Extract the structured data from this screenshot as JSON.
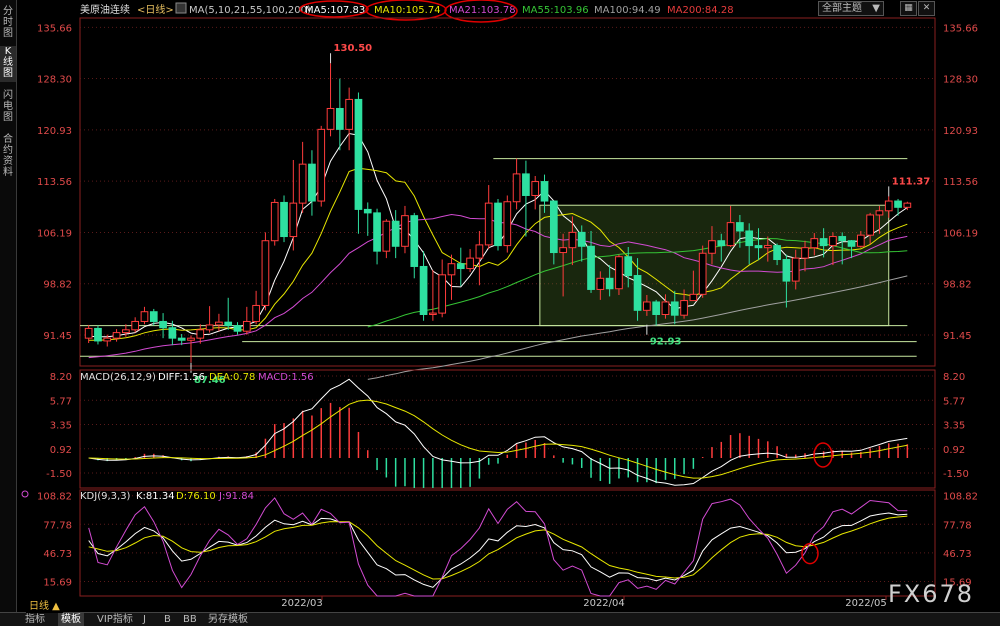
{
  "sidebar": {
    "tabs": [
      {
        "label": "分时图"
      },
      {
        "label": "K线图"
      },
      {
        "label": "闪电图"
      },
      {
        "label": "合约资料"
      }
    ]
  },
  "header": {
    "symbol": "美原油连续",
    "period": "<日线>",
    "ma_params": "MA(5,10,21,55,100,200)",
    "ma5": "MA5:107.83",
    "ma10": "MA10:105.74",
    "ma21": "MA21:103.78",
    "ma55": "MA55:103.96",
    "ma100": "MA100:94.49",
    "ma200": "MA200:84.28",
    "theme": "全部主题",
    "colors": {
      "ma5": "#ffffff",
      "ma10": "#e6e600",
      "ma21": "#d24bd2",
      "ma55": "#35c435",
      "ma100": "#a0a0a0",
      "ma200": "#e63c3c"
    }
  },
  "macd_header": {
    "name": "MACD(26,12,9)",
    "diff": "DIFF:1.56",
    "dea": "DEA:0.78",
    "macd": "MACD:1.56"
  },
  "kdj_header": {
    "name": "KDJ(9,3,3)",
    "k": "K:81.34",
    "d": "D:76.10",
    "j": "J:91.84"
  },
  "bottom": {
    "period_label": "日线",
    "tabs": [
      "指标",
      "模板",
      "VIP指标",
      "J",
      "B",
      "BB",
      "另存模板"
    ]
  },
  "watermark": "FX678",
  "chart_data": [
    {
      "type": "candlestick",
      "title": "美原油连续 <日线>",
      "ylim": [
        87,
        137
      ],
      "y_ticks": [
        135.66,
        128.3,
        120.93,
        113.56,
        106.19,
        98.82,
        91.45
      ],
      "x_tick_labels": [
        "2022/03",
        "2022/04",
        "2022/05"
      ],
      "annotations": [
        {
          "text": "130.50",
          "value": 130.5
        },
        {
          "text": "111.37",
          "value": 111.37
        },
        {
          "text": "92.93",
          "value": 92.93
        },
        {
          "text": "87.46",
          "value": 87.46
        }
      ],
      "horizontal_levels": [
        116.8,
        110.1,
        92.8,
        90.5,
        88.4
      ],
      "candles": [
        [
          91.0,
          92.4,
          90.3,
          92.9
        ],
        [
          92.4,
          90.6,
          90.1,
          92.8
        ],
        [
          90.6,
          91.0,
          89.8,
          91.5
        ],
        [
          91.0,
          91.8,
          90.5,
          92.3
        ],
        [
          91.8,
          92.2,
          91.2,
          93.0
        ],
        [
          92.2,
          93.4,
          91.8,
          94.0
        ],
        [
          93.4,
          94.8,
          93.0,
          95.5
        ],
        [
          94.8,
          93.4,
          92.8,
          95.2
        ],
        [
          93.4,
          92.5,
          91.0,
          94.6
        ],
        [
          92.5,
          91.0,
          90.0,
          93.5
        ],
        [
          91.0,
          90.7,
          90.0,
          91.6
        ],
        [
          90.7,
          91.0,
          87.5,
          91.4
        ],
        [
          91.0,
          92.2,
          90.2,
          93.0
        ],
        [
          92.2,
          92.9,
          91.8,
          95.6
        ],
        [
          92.9,
          93.3,
          92.0,
          94.5
        ],
        [
          93.3,
          92.8,
          92.2,
          96.8
        ],
        [
          92.8,
          92.0,
          91.5,
          93.3
        ],
        [
          92.0,
          93.4,
          91.5,
          95.5
        ],
        [
          93.4,
          95.7,
          93.0,
          97.8
        ],
        [
          95.7,
          105.0,
          95.0,
          106.2
        ],
        [
          105.0,
          110.5,
          104.3,
          111.0
        ],
        [
          110.5,
          105.6,
          104.8,
          111.5
        ],
        [
          105.6,
          110.4,
          103.6,
          116.6
        ],
        [
          110.4,
          116.0,
          109.0,
          119.2
        ],
        [
          116.0,
          110.7,
          108.6,
          118.0
        ],
        [
          110.7,
          121.0,
          109.9,
          121.5
        ],
        [
          121.0,
          124.0,
          120.0,
          130.5
        ],
        [
          124.0,
          121.0,
          118.0,
          128.3
        ],
        [
          121.0,
          125.3,
          118.0,
          127.0
        ],
        [
          125.3,
          109.5,
          106.0,
          126.3
        ],
        [
          109.5,
          109.0,
          105.7,
          110.5
        ],
        [
          109.0,
          103.5,
          101.6,
          109.6
        ],
        [
          103.5,
          107.8,
          102.5,
          108.1
        ],
        [
          107.8,
          104.2,
          102.5,
          109.4
        ],
        [
          104.2,
          108.6,
          103.2,
          110.0
        ],
        [
          108.6,
          101.3,
          99.6,
          109.0
        ],
        [
          101.3,
          94.4,
          93.5,
          103.5
        ],
        [
          94.4,
          94.6,
          93.5,
          100.8
        ],
        [
          94.6,
          100.1,
          94.0,
          102.3
        ],
        [
          100.1,
          101.7,
          96.5,
          103.0
        ],
        [
          101.7,
          101.0,
          98.5,
          104.0
        ],
        [
          101.0,
          102.5,
          100.5,
          103.8
        ],
        [
          102.5,
          104.4,
          98.6,
          106.4
        ],
        [
          104.4,
          110.4,
          103.8,
          113.0
        ],
        [
          110.4,
          104.3,
          103.6,
          111.0
        ],
        [
          104.3,
          110.6,
          103.3,
          111.5
        ],
        [
          110.6,
          114.6,
          109.5,
          116.8
        ],
        [
          114.6,
          111.5,
          105.6,
          116.5
        ],
        [
          111.5,
          113.5,
          109.5,
          114.3
        ],
        [
          113.5,
          110.7,
          109.0,
          114.5
        ],
        [
          110.7,
          103.3,
          101.6,
          110.8
        ],
        [
          103.3,
          104.0,
          97.0,
          106.0
        ],
        [
          104.0,
          106.2,
          101.5,
          108.5
        ],
        [
          106.2,
          104.2,
          102.0,
          107.2
        ],
        [
          104.2,
          98.0,
          97.5,
          106.4
        ],
        [
          98.0,
          99.6,
          96.5,
          100.6
        ],
        [
          99.6,
          98.1,
          97.0,
          101.5
        ],
        [
          98.1,
          102.7,
          97.2,
          103.0
        ],
        [
          102.7,
          100.0,
          98.3,
          104.1
        ],
        [
          100.0,
          95.0,
          93.5,
          102.5
        ],
        [
          95.0,
          96.2,
          94.2,
          97.2
        ],
        [
          96.2,
          94.4,
          92.8,
          96.5
        ],
        [
          94.4,
          96.2,
          93.8,
          97.3
        ],
        [
          96.2,
          94.3,
          93.0,
          97.8
        ],
        [
          94.3,
          96.4,
          93.8,
          98.0
        ],
        [
          96.4,
          97.3,
          96.5,
          100.7
        ],
        [
          97.3,
          103.2,
          96.8,
          104.3
        ],
        [
          103.2,
          105.0,
          101.6,
          107.1
        ],
        [
          105.0,
          104.3,
          102.0,
          106.0
        ],
        [
          104.3,
          107.6,
          104.1,
          110.0
        ],
        [
          107.6,
          106.4,
          104.0,
          108.7
        ],
        [
          106.4,
          104.3,
          101.6,
          107.5
        ],
        [
          104.3,
          104.0,
          102.2,
          106.8
        ],
        [
          104.0,
          104.3,
          102.0,
          105.6
        ],
        [
          104.3,
          102.3,
          101.5,
          104.6
        ],
        [
          102.3,
          99.2,
          95.4,
          103.0
        ],
        [
          99.2,
          102.5,
          98.0,
          103.7
        ],
        [
          102.5,
          104.0,
          100.6,
          105.0
        ],
        [
          104.0,
          105.3,
          102.9,
          106.1
        ],
        [
          105.3,
          104.3,
          102.6,
          106.8
        ],
        [
          104.3,
          105.6,
          101.5,
          106.2
        ],
        [
          105.6,
          105.0,
          101.6,
          106.2
        ],
        [
          105.0,
          104.2,
          102.5,
          105.1
        ],
        [
          104.2,
          105.8,
          104.0,
          106.4
        ],
        [
          105.8,
          108.7,
          104.5,
          109.0
        ],
        [
          108.7,
          109.3,
          106.0,
          110.0
        ],
        [
          109.3,
          110.7,
          108.3,
          111.4
        ],
        [
          110.7,
          109.8,
          108.6,
          111.0
        ],
        [
          109.8,
          110.4,
          109.4,
          110.6
        ]
      ]
    },
    {
      "type": "line",
      "title": "MACD(26,12,9)",
      "ylim": [
        -3.0,
        8.8
      ],
      "y_ticks": [
        8.2,
        5.77,
        3.35,
        0.92,
        -1.5
      ],
      "series": [
        {
          "name": "DIFF",
          "last": 1.56
        },
        {
          "name": "DEA",
          "last": 0.78
        },
        {
          "name": "MACD",
          "last": 1.56
        }
      ]
    },
    {
      "type": "line",
      "title": "KDJ(9,3,3)",
      "ylim": [
        0,
        115
      ],
      "y_ticks": [
        108.82,
        77.78,
        46.73,
        15.69
      ],
      "series": [
        {
          "name": "K",
          "last": 81.34
        },
        {
          "name": "D",
          "last": 76.1
        },
        {
          "name": "J",
          "last": 91.84
        }
      ]
    }
  ]
}
